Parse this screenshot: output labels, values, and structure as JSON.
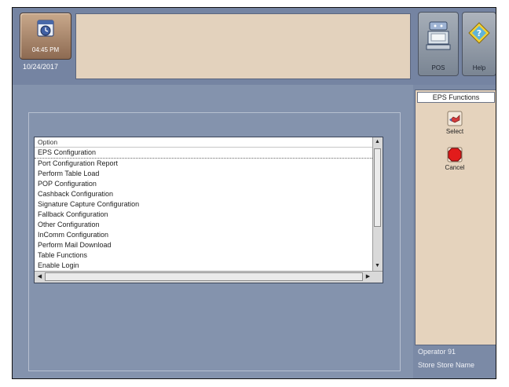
{
  "header": {
    "clock_time": "04:45 PM",
    "date": "10/24/2017"
  },
  "toolbar": {
    "pos_label": "POS",
    "help_label": "Help"
  },
  "option_list": {
    "header": "Option",
    "items": [
      "EPS Configuration",
      "Port Configuration Report",
      "Perform Table Load",
      "POP Configuration",
      "Cashback Configuration",
      "Signature Capture Configuration",
      "Fallback Configuration",
      "Other Configuration",
      "InComm Configuration",
      "Perform Mail Download",
      "Table Functions",
      "Enable Login"
    ],
    "selected_index": 0
  },
  "side_panel": {
    "title": "EPS Functions",
    "select_label": "Select",
    "cancel_label": "Cancel"
  },
  "footer": {
    "operator": "Operator 91",
    "store": "Store Store Name"
  }
}
